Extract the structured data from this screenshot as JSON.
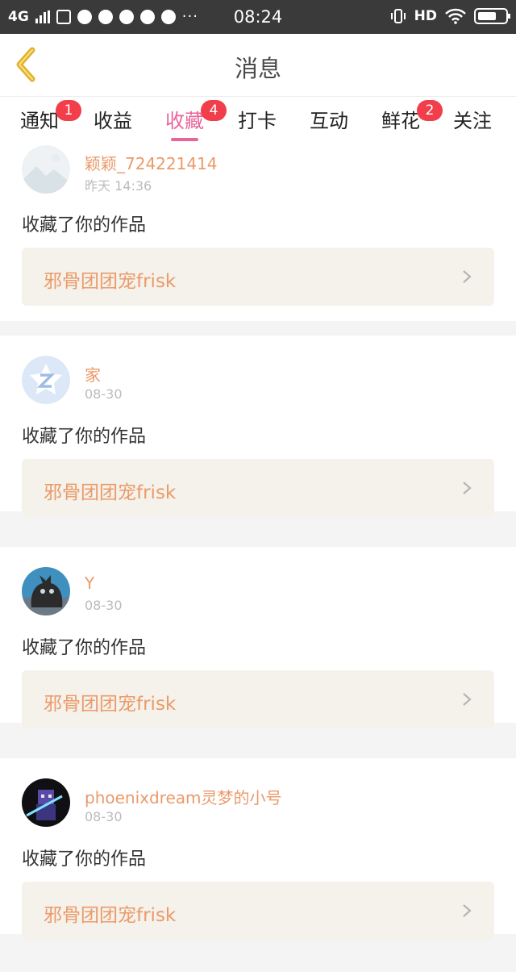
{
  "status_bar": {
    "network": "4G",
    "time": "08:24",
    "dots": "···",
    "hd": "HD"
  },
  "header": {
    "title": "消息",
    "back_icon": "back-chevron-icon"
  },
  "tabs": [
    {
      "label": "通知",
      "badge": "1",
      "active": false
    },
    {
      "label": "收益",
      "badge": "",
      "active": false
    },
    {
      "label": "收藏",
      "badge": "4",
      "active": true
    },
    {
      "label": "打卡",
      "badge": "",
      "active": false
    },
    {
      "label": "互动",
      "badge": "",
      "active": false
    },
    {
      "label": "鲜花",
      "badge": "2",
      "active": false
    },
    {
      "label": "关注",
      "badge": "",
      "active": false
    }
  ],
  "messages": [
    {
      "username": "颖颖_724221414",
      "time": "昨天 14:36",
      "action": "收藏了你的作品",
      "work_title": "邪骨团团宠frisk",
      "avatar": "landscape-avatar"
    },
    {
      "username": "家",
      "time": "08-30",
      "action": "收藏了你的作品",
      "work_title": "邪骨团团宠frisk",
      "avatar": "default-z-avatar"
    },
    {
      "username": "Y",
      "time": "08-30",
      "action": "收藏了你的作品",
      "work_title": "邪骨团团宠frisk",
      "avatar": "black-cat-avatar"
    },
    {
      "username": "phoenixdream灵梦的小号",
      "time": "08-30",
      "action": "收藏了你的作品",
      "work_title": "邪骨团团宠frisk",
      "avatar": "pixel-character-avatar"
    }
  ],
  "colors": {
    "accent": "#e8659b",
    "badge": "#f23d4a",
    "username": "#eb9a6a",
    "card_work_bg": "#f4f2ea"
  }
}
